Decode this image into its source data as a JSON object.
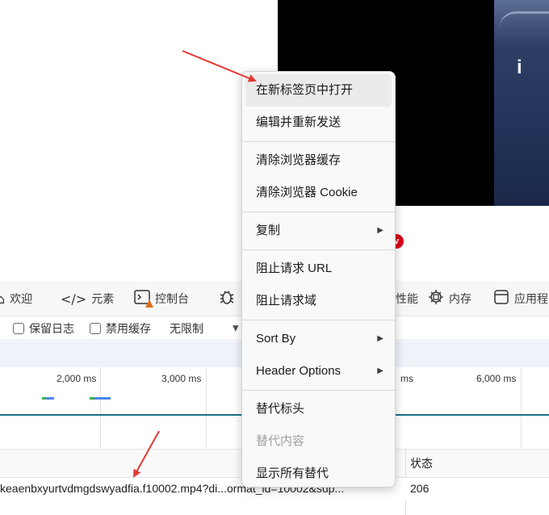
{
  "page": {
    "video_overlay_glyph": "i",
    "badge_glyph": "v"
  },
  "devtools": {
    "tabs": [
      {
        "label": "欢迎",
        "icon": "home-icon"
      },
      {
        "label": "元素",
        "icon": "code-icon"
      },
      {
        "label": "控制台",
        "icon": "console-icon"
      },
      {
        "label": "",
        "icon": "bug-icon"
      },
      {
        "label": "性能",
        "icon": "performance-icon"
      },
      {
        "label": "内存",
        "icon": "memory-chip-icon"
      },
      {
        "label": "应用程",
        "icon": "application-icon"
      }
    ],
    "toolbar": {
      "preserve_log": "保留日志",
      "disable_cache": "禁用缓存",
      "throttling": "无限制"
    },
    "timeline_ticks": [
      "2,000 ms",
      "3,000 ms",
      "ms",
      "6,000 ms"
    ],
    "columns": {
      "status": "状态"
    },
    "request_row": {
      "name": "keaenbxyurtvdmgdswyadfia.f10002.mp4?di...ormat_id=10002&sup...",
      "status": "206"
    }
  },
  "context_menu": {
    "open_in_new_tab": "在新标签页中打开",
    "edit_and_resend": "编辑并重新发送",
    "clear_browser_cache": "清除浏览器缓存",
    "clear_browser_cookie": "清除浏览器 Cookie",
    "copy": "复制",
    "block_request_url": "阻止请求 URL",
    "block_request_domain": "阻止请求域",
    "sort_by": "Sort By",
    "header_options": "Header Options",
    "override_headers": "替代标头",
    "override_content": "替代内容",
    "show_all_overrides": "显示所有替代"
  },
  "colors": {
    "menu_hover": "#ebebeb",
    "annotation_arrow": "#e53935",
    "timeline_line": "#1c6f86"
  }
}
